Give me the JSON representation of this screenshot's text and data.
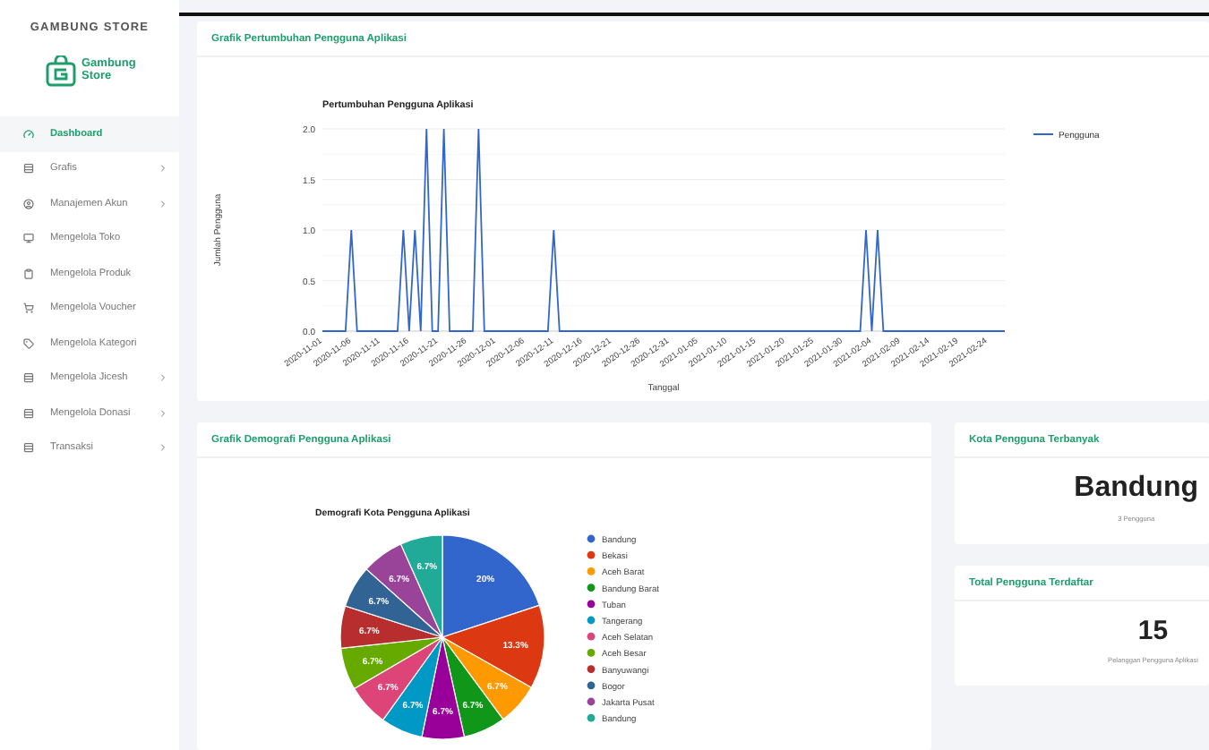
{
  "sidebar": {
    "brand": "GAMBUNG STORE",
    "logo_text": "Gambung Store",
    "items": [
      {
        "label": "Dashboard",
        "selected": true,
        "expandable": false
      },
      {
        "label": "Grafis",
        "selected": false,
        "expandable": true
      },
      {
        "label": "Manajemen Akun",
        "selected": false,
        "expandable": true
      },
      {
        "label": "Mengelola Toko",
        "selected": false,
        "expandable": false
      },
      {
        "label": "Mengelola Produk",
        "selected": false,
        "expandable": false
      },
      {
        "label": "Mengelola Voucher",
        "selected": false,
        "expandable": false
      },
      {
        "label": "Mengelola Kategori",
        "selected": false,
        "expandable": false
      },
      {
        "label": "Mengelola Jicesh",
        "selected": false,
        "expandable": true
      },
      {
        "label": "Mengelola Donasi",
        "selected": false,
        "expandable": true
      },
      {
        "label": "Transaksi",
        "selected": false,
        "expandable": true
      }
    ]
  },
  "growth_card": {
    "title": "Grafik Pertumbuhan Pengguna Aplikasi",
    "chart_data": {
      "type": "line",
      "title": "Pertumbuhan Pengguna Aplikasi",
      "xlabel": "Tanggal",
      "ylabel": "Jumlah Pengguna",
      "grid": true,
      "legend": "right",
      "ylim": [
        0,
        2
      ],
      "yticks": [
        {
          "value": 0,
          "label": "0.0"
        },
        {
          "value": 0.5,
          "label": "0.5"
        },
        {
          "value": 1,
          "label": "1.0"
        },
        {
          "value": 1.5,
          "label": "1.5"
        },
        {
          "value": 2,
          "label": "2.0"
        }
      ],
      "categories": [
        "2020-11-01",
        null,
        null,
        null,
        null,
        "2020-11-06",
        null,
        null,
        null,
        null,
        "2020-11-11",
        null,
        null,
        null,
        null,
        "2020-11-16",
        null,
        null,
        null,
        null,
        "2020-11-21",
        null,
        null,
        null,
        null,
        "2020-11-26",
        null,
        null,
        null,
        null,
        "2020-12-01",
        null,
        null,
        null,
        null,
        "2020-12-06",
        null,
        null,
        null,
        null,
        "2020-12-11",
        null,
        null,
        null,
        null,
        "2020-12-16",
        null,
        null,
        null,
        null,
        "2020-12-21",
        null,
        null,
        null,
        null,
        "2020-12-26",
        null,
        null,
        null,
        null,
        "2020-12-31",
        null,
        null,
        null,
        null,
        "2021-01-05",
        null,
        null,
        null,
        null,
        "2021-01-10",
        null,
        null,
        null,
        null,
        "2021-01-15",
        null,
        null,
        null,
        null,
        "2021-01-20",
        null,
        null,
        null,
        null,
        "2021-01-25",
        null,
        null,
        null,
        null,
        "2021-01-30",
        null,
        null,
        null,
        null,
        "2021-02-04",
        null,
        null,
        null,
        null,
        "2021-02-09",
        null,
        null,
        null,
        null,
        "2021-02-14",
        null,
        null,
        null,
        null,
        "2021-02-19",
        null,
        null,
        null,
        null,
        "2021-02-24",
        null,
        null,
        null
      ],
      "series": [
        {
          "name": "Pengguna",
          "color": "#3366cc",
          "values": [
            0,
            0,
            0,
            0,
            0,
            1,
            0,
            0,
            0,
            0,
            0,
            0,
            0,
            0,
            1,
            0,
            1,
            0,
            2,
            0,
            0,
            2,
            0,
            0,
            0,
            0,
            0,
            2,
            0,
            0,
            0,
            0,
            0,
            0,
            0,
            0,
            0,
            0,
            0,
            0,
            1,
            0,
            0,
            0,
            0,
            0,
            0,
            0,
            0,
            0,
            0,
            0,
            0,
            0,
            0,
            0,
            0,
            0,
            0,
            0,
            0,
            0,
            0,
            0,
            0,
            0,
            0,
            0,
            0,
            0,
            0,
            0,
            0,
            0,
            0,
            0,
            0,
            0,
            0,
            0,
            0,
            0,
            0,
            0,
            0,
            0,
            0,
            0,
            0,
            0,
            0,
            0,
            0,
            0,
            1,
            0,
            1,
            0,
            0,
            0,
            0,
            0,
            0,
            0,
            0,
            0,
            0,
            0,
            0,
            0,
            0,
            0,
            0,
            0,
            0,
            0,
            0,
            0,
            0
          ]
        }
      ]
    }
  },
  "demography_card": {
    "title": "Grafik Demografi Pengguna Aplikasi",
    "chart_data": {
      "type": "pie",
      "title": "Demografi Kota Pengguna Aplikasi",
      "data_labels": "value_labels",
      "legend": "right",
      "categories": [
        "Bandung",
        "Bekasi",
        "Aceh Barat",
        "Bandung Barat",
        "Tuban",
        "Tangerang",
        "Aceh Selatan",
        "Aceh Besar",
        "Banyuwangi",
        "Bogor",
        "Jakarta Pusat",
        "Bandung"
      ],
      "series": [
        {
          "values": [
            20,
            13.3,
            6.7,
            6.7,
            6.7,
            6.7,
            6.7,
            6.7,
            6.7,
            6.7,
            6.7,
            6.7
          ]
        }
      ],
      "value_labels": [
        "20%",
        "13.3%",
        "6.7%",
        "6.7%",
        "6.7%",
        "6.7%",
        "6.7%",
        "6.7%",
        "6.7%",
        "6.7%",
        "6.7%",
        "6.7%"
      ],
      "colors": [
        "#3366cc",
        "#dc3912",
        "#ff9900",
        "#109618",
        "#990099",
        "#0099c6",
        "#dd4477",
        "#66aa00",
        "#b82e2e",
        "#316395",
        "#994499",
        "#22aa99"
      ]
    }
  },
  "stat_cards": [
    {
      "title": "Kota Pengguna Terbanyak",
      "value": "Bandung",
      "caption": "3 Pengguna"
    },
    {
      "title": "Total Pengguna Terdaftar",
      "value": "15",
      "caption": "Pelanggan Pengguna Aplikasi"
    }
  ]
}
